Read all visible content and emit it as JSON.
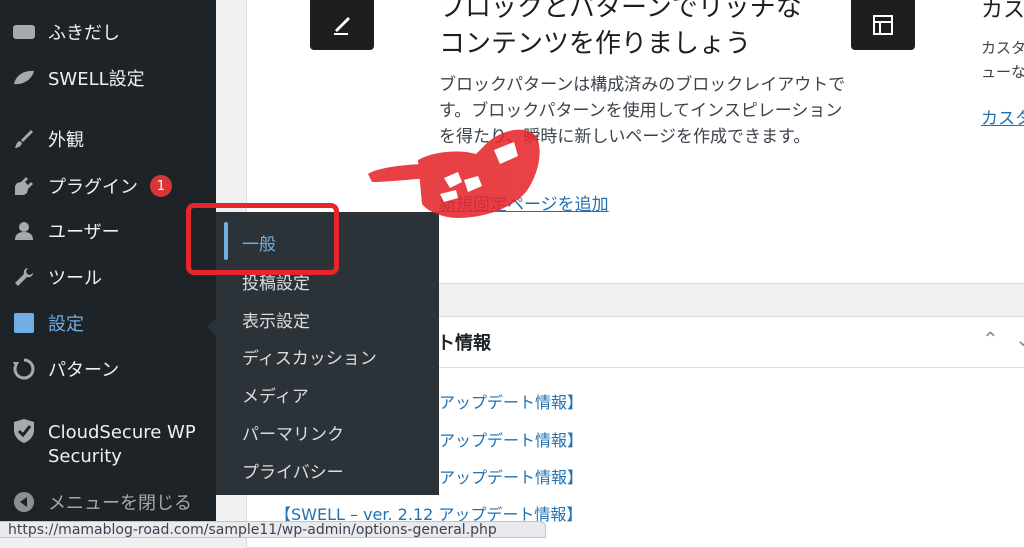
{
  "sidebar": {
    "items": [
      {
        "label": "ふきだし",
        "icon": "speech-bubble-icon"
      },
      {
        "label": "SWELL設定",
        "icon": "swell-leaf-icon"
      },
      {
        "label": "外観",
        "icon": "paintbrush-icon"
      },
      {
        "label": "プラグイン",
        "icon": "plugin-icon",
        "badge": "1"
      },
      {
        "label": "ユーザー",
        "icon": "user-icon"
      },
      {
        "label": "ツール",
        "icon": "wrench-icon"
      },
      {
        "label": "設定",
        "icon": "settings-sliders-icon"
      },
      {
        "label": "パターン",
        "icon": "pattern-refresh-icon"
      },
      {
        "label": "CloudSecure WP Security",
        "icon": "shield-check-icon"
      },
      {
        "label": "メニューを閉じる",
        "icon": "collapse-arrow-icon"
      }
    ]
  },
  "flyout": {
    "items": [
      "一般",
      "投稿設定",
      "表示設定",
      "ディスカッション",
      "メディア",
      "パーマリンク",
      "プライバシー"
    ]
  },
  "welcome": {
    "pattern_title_line1": "ブロックとパターンでリッチな",
    "pattern_title_line2": "コンテンツを作りましょう",
    "pattern_desc": "ブロックパターンは構成済みのブロックレイアウトです。ブロックパターンを使用してインスピレーションを得たり、瞬時に新しいページを作成できます。",
    "pattern_link": "新規固定ページを追加",
    "custom_title": "カスタ",
    "custom_desc": "カスタマ ニューな",
    "custom_link": "カスタマ"
  },
  "news": {
    "title": "ト情報",
    "items": [
      "アップデート情報】",
      "アップデート情報】",
      "アップデート情報】",
      "【SWELL – ver. 2.12 アップデート情報】"
    ]
  },
  "status_bar": {
    "url": "https://mamablog-road.com/sample11/wp-admin/options-general.php"
  },
  "colors": {
    "sidebar_bg": "#1d2327",
    "flyout_bg": "#2c3338",
    "accent": "#72aee6",
    "link": "#2271b1",
    "badge": "#d63638",
    "highlight": "#e5272c"
  }
}
